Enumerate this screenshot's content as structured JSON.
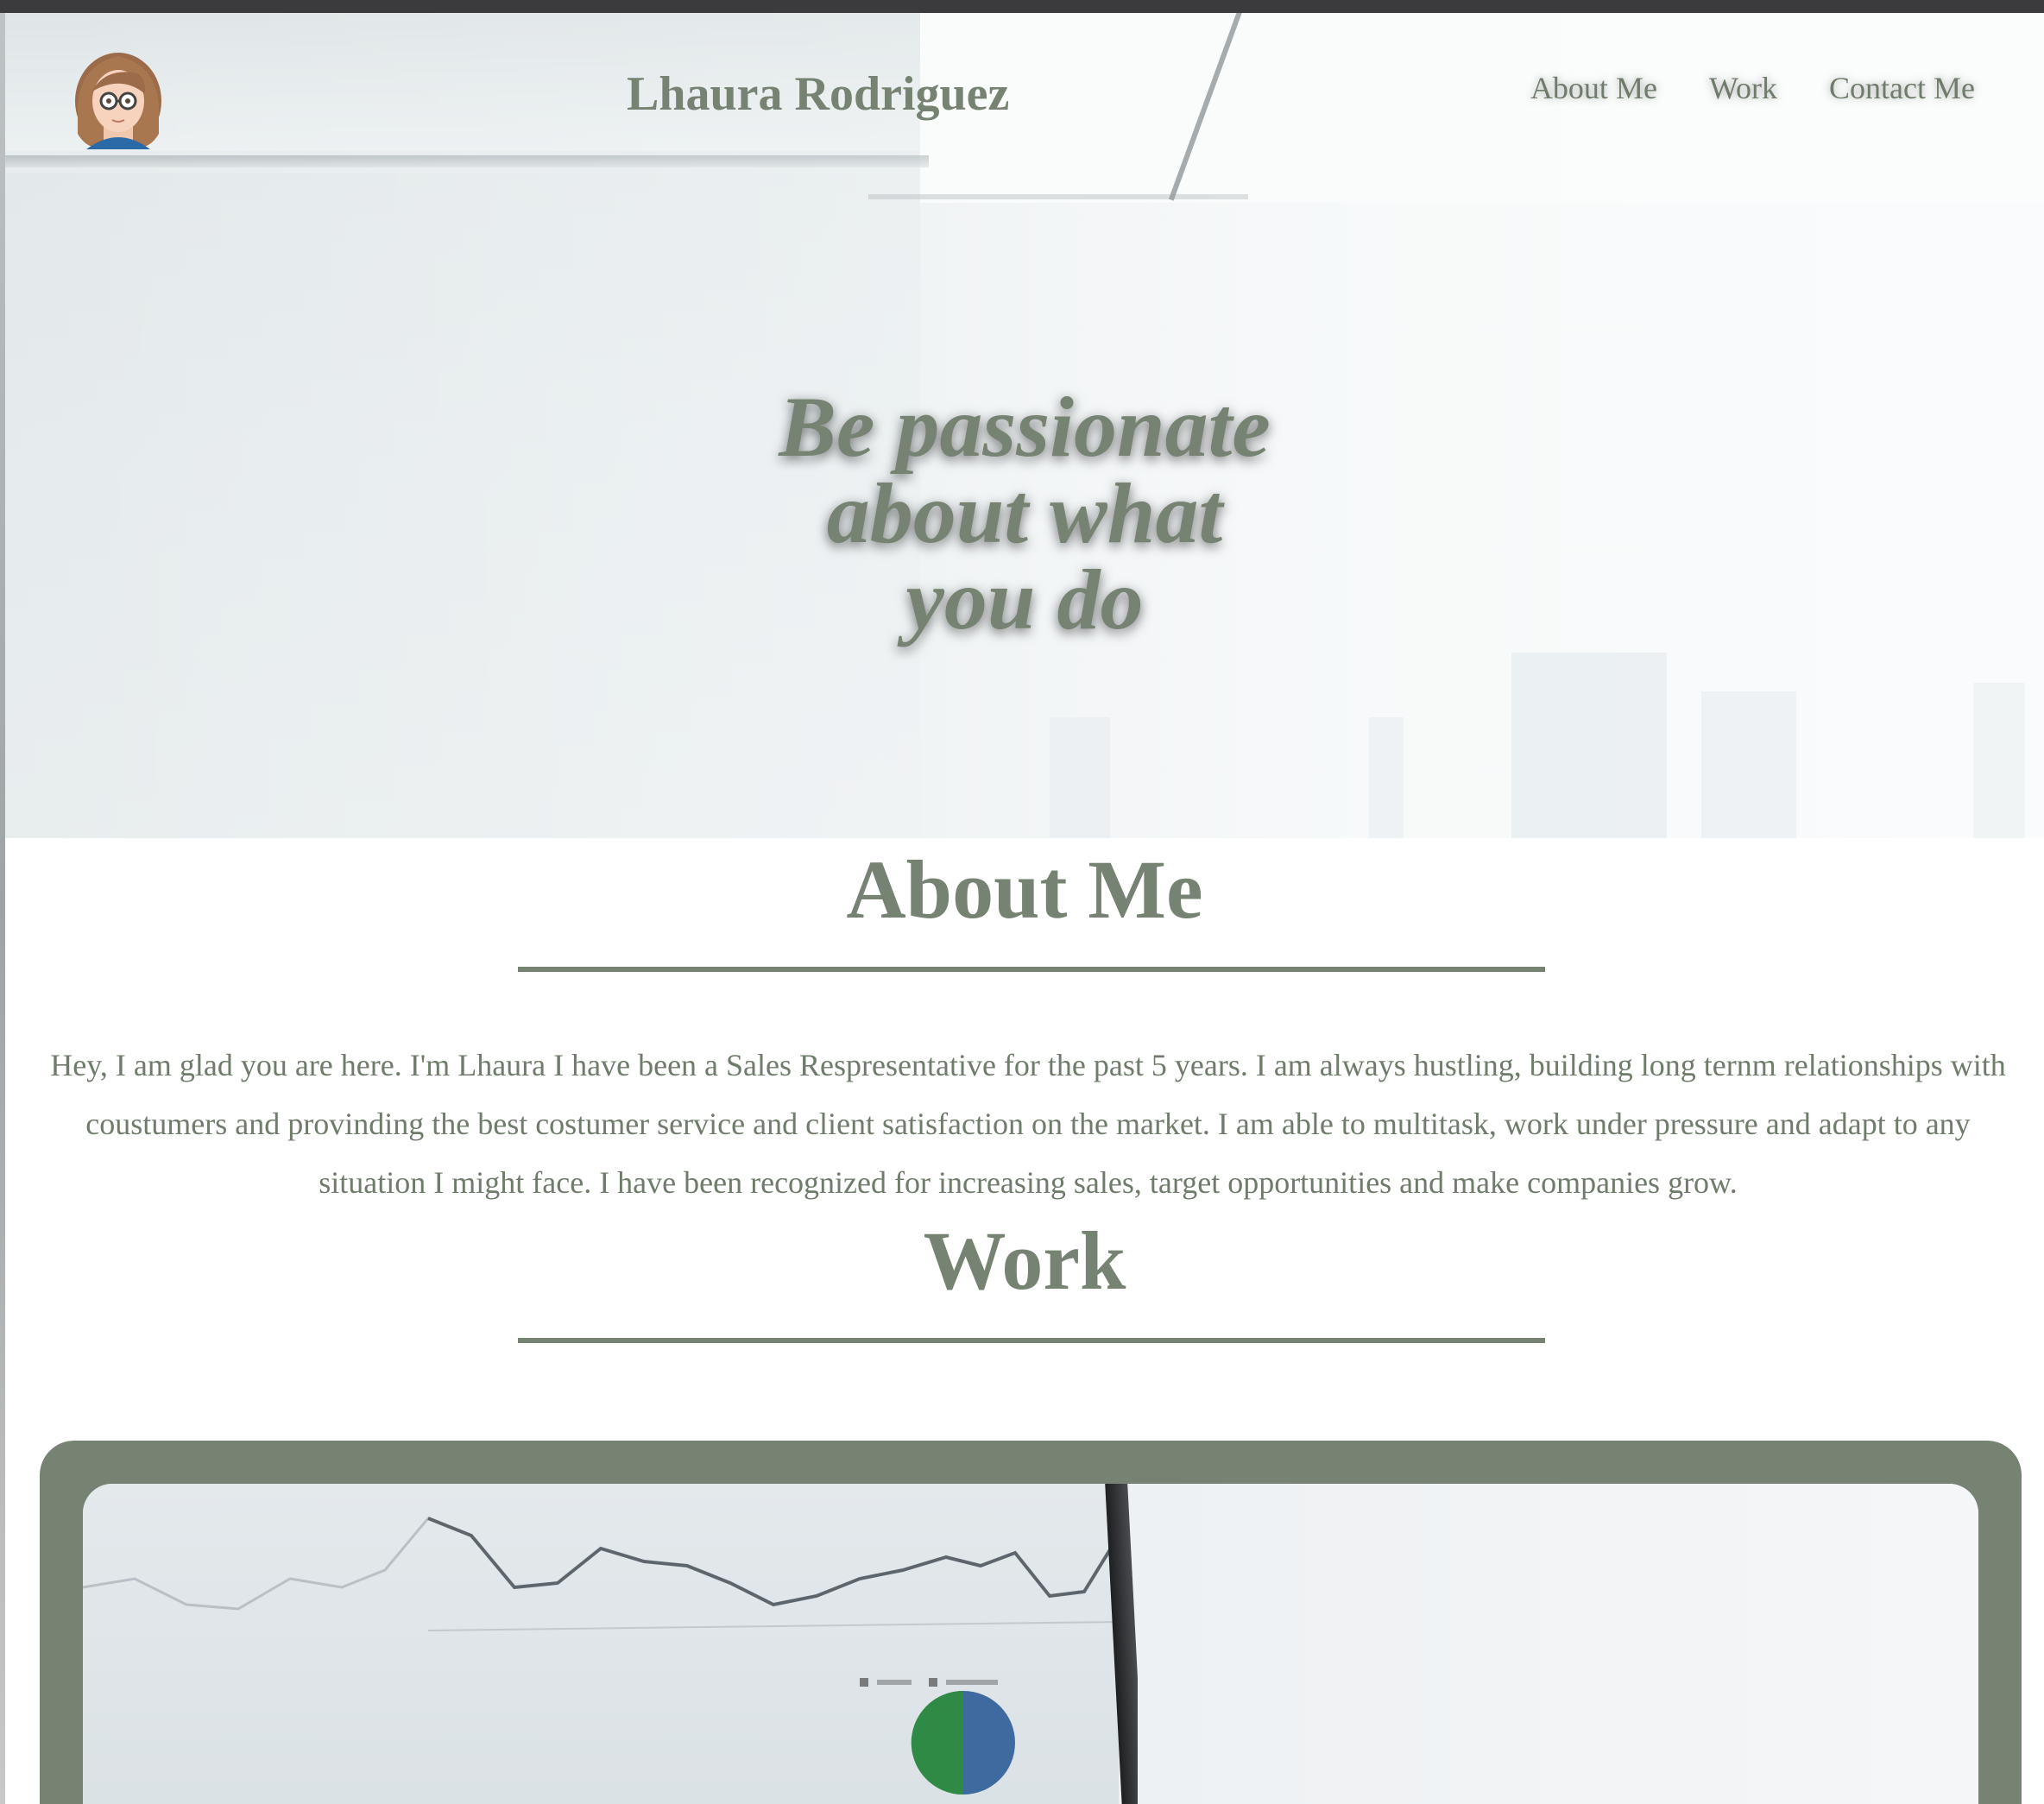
{
  "header": {
    "brand": "Lhaura Rodriguez",
    "avatar_icon": "avatar-icon",
    "nav": [
      {
        "label": "About Me"
      },
      {
        "label": "Work"
      },
      {
        "label": "Contact Me"
      }
    ]
  },
  "hero": {
    "tagline_lines": [
      "Be passionate",
      "about what",
      "you do"
    ]
  },
  "about": {
    "title": "About Me",
    "text": "Hey, I am glad you are here. I'm Lhaura I have been a Sales Respresentative for the past 5 years. I am always hustling, building long ternm relationships with coustumers and provinding the best costumer service and client satisfaction on the market. I am able to multitask, work under pressure and adapt to any situation I might face. I have been recognized for increasing sales, target opportunities and make companies grow."
  },
  "work": {
    "title": "Work"
  },
  "colors": {
    "accent": "#768373",
    "text": "#6f7c6b",
    "top_strip": "#3b3b3d"
  }
}
